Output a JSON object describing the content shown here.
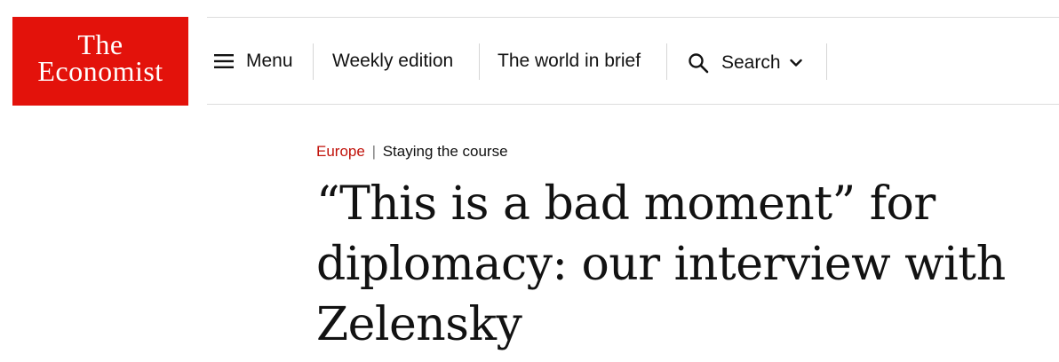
{
  "logo": {
    "line1": "The",
    "line2": "Economist",
    "background_color": "#e3120b"
  },
  "nav": {
    "menu_label": "Menu",
    "menu_icon": "hamburger-icon",
    "weekly_edition_label": "Weekly edition",
    "world_in_brief_label": "The world in brief",
    "search_label": "Search",
    "search_icon": "search-icon",
    "search_dropdown_icon": "chevron-down-icon"
  },
  "article": {
    "section": "Europe",
    "separator": "|",
    "rubric": "Staying the course",
    "headline": "“This is a bad moment” for diplomacy: our interview with Zelensky",
    "section_color": "#c1120a"
  }
}
